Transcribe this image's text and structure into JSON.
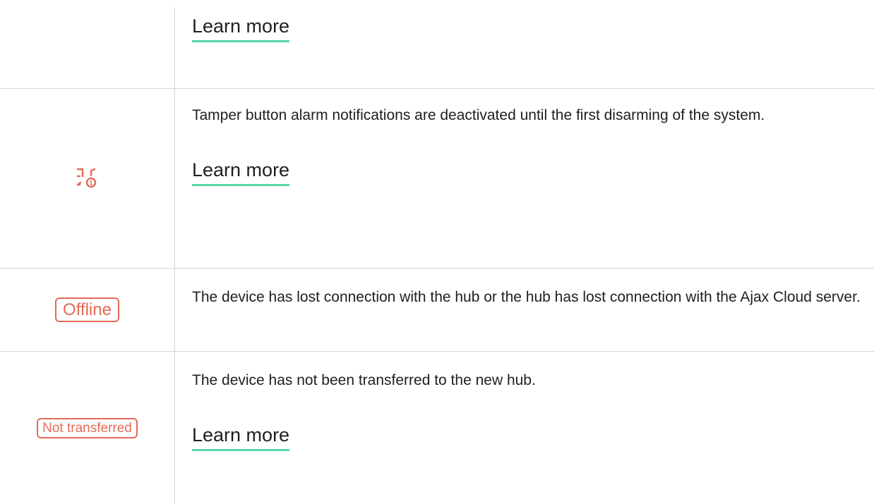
{
  "rows": [
    {
      "learn_more": "Learn more"
    },
    {
      "icon": "tamper-first-disarm-icon",
      "description": "Tamper button alarm notifications are deactivated until the first disarming of the system.",
      "learn_more": "Learn more"
    },
    {
      "badge": "Offline",
      "description": "The device has lost connection with the hub or the hub has lost connection with the Ajax Cloud server."
    },
    {
      "badge": "Not transferred",
      "description": "The device has not been transferred to the new hub.",
      "learn_more": "Learn more"
    }
  ],
  "colors": {
    "status_red": "#e36a58",
    "link_underline": "#5ad6a4",
    "divider": "#d6d6d6",
    "text": "#1f1f1f"
  }
}
